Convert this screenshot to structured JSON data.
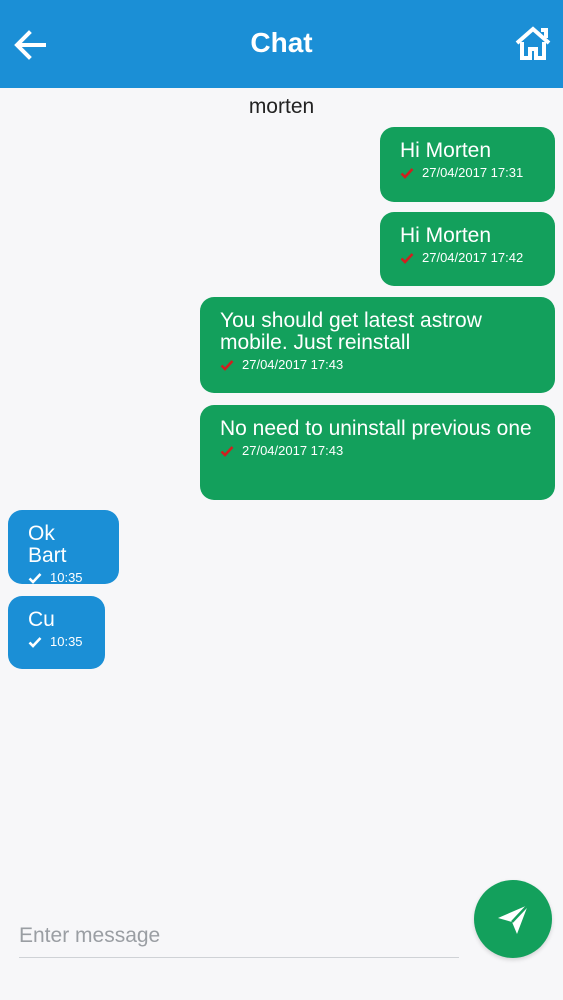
{
  "header": {
    "title": "Chat",
    "back_icon": "arrow-left-icon",
    "home_icon": "home-icon",
    "color": "#1b8fd6"
  },
  "contact": {
    "name": "morten"
  },
  "messages": [
    {
      "direction": "out",
      "text": "Hi Morten",
      "timestamp": "27/04/2017 17:31",
      "status_icon": "check-icon",
      "tick_color": "#d11f1f"
    },
    {
      "direction": "out",
      "text": "Hi Morten",
      "timestamp": "27/04/2017 17:42",
      "status_icon": "check-icon",
      "tick_color": "#d11f1f"
    },
    {
      "direction": "out",
      "text": "You should get latest astrow mobile. Just reinstall",
      "timestamp": "27/04/2017 17:43",
      "status_icon": "check-icon",
      "tick_color": "#d11f1f"
    },
    {
      "direction": "out",
      "text": "No need to uninstall previous one",
      "timestamp": "27/04/2017 17:43",
      "status_icon": "check-icon",
      "tick_color": "#d11f1f"
    },
    {
      "direction": "in",
      "text": "Ok Bart",
      "timestamp": "10:35",
      "status_icon": "check-icon",
      "tick_color": "#ffffff"
    },
    {
      "direction": "in",
      "text": "Cu",
      "timestamp": "10:35",
      "status_icon": "check-icon",
      "tick_color": "#ffffff"
    }
  ],
  "composer": {
    "placeholder": "Enter message",
    "value": "",
    "send_icon": "send-icon"
  },
  "colors": {
    "outgoing_bubble": "#13a05c",
    "incoming_bubble": "#1b8fd6",
    "send_button": "#13a05c"
  }
}
